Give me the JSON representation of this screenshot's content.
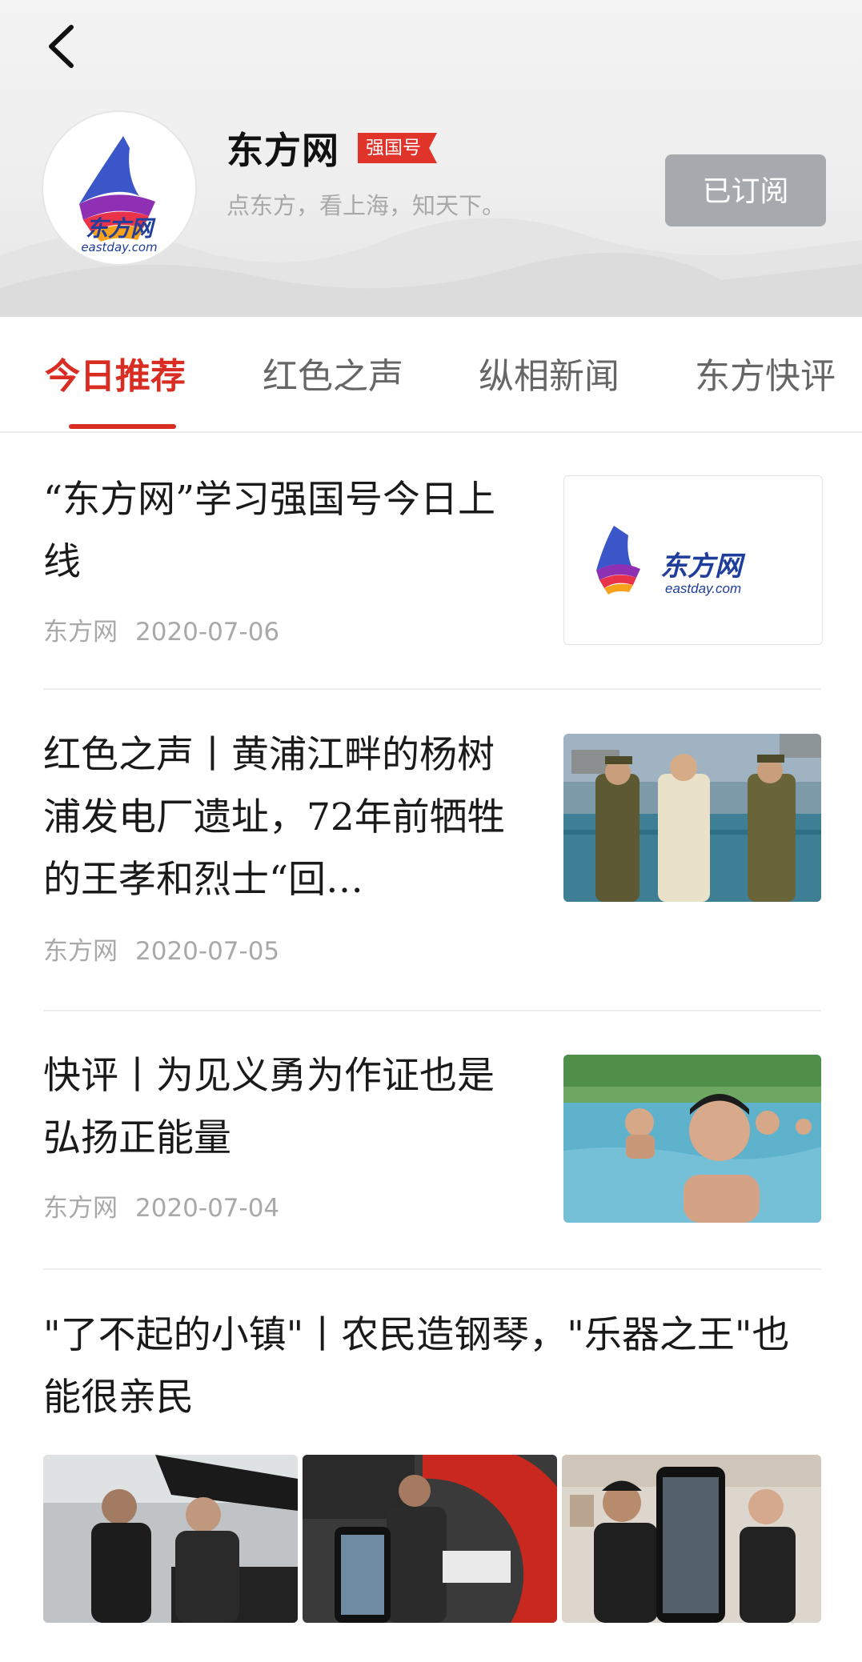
{
  "channel": {
    "name": "东方网",
    "badge": "强国号",
    "slogan": "点东方，看上海，知天下。",
    "subscribe_label": "已订阅",
    "logo_text": "东方网",
    "logo_domain": "eastday.com"
  },
  "tabs": [
    {
      "label": "今日推荐",
      "active": true
    },
    {
      "label": "红色之声",
      "active": false
    },
    {
      "label": "纵相新闻",
      "active": false
    },
    {
      "label": "东方快评",
      "active": false
    }
  ],
  "articles": [
    {
      "title": "“东方网”学习强国号今日上线",
      "source": "东方网",
      "date": "2020-07-06",
      "thumb": "eastday-logo-image"
    },
    {
      "title": "红色之声丨黄浦江畔的杨树浦发电厂遗址，72年前牺牲的王孝和烈士“回…",
      "source": "东方网",
      "date": "2020-07-05",
      "thumb": "reenactment-photo"
    },
    {
      "title": "快评丨为见义勇为作证也是弘扬正能量",
      "source": "东方网",
      "date": "2020-07-04",
      "thumb": "swimming-pool-photo"
    },
    {
      "title": "\"了不起的小镇\"丨农民造钢琴，\"乐器之王\"也能很亲民",
      "thumbs": [
        "piano-photo-1",
        "piano-photo-2",
        "piano-photo-3"
      ]
    }
  ],
  "colors": {
    "accent": "#d92c23",
    "button_gray": "#a6a9ae",
    "meta_gray": "#a9a9a9"
  }
}
